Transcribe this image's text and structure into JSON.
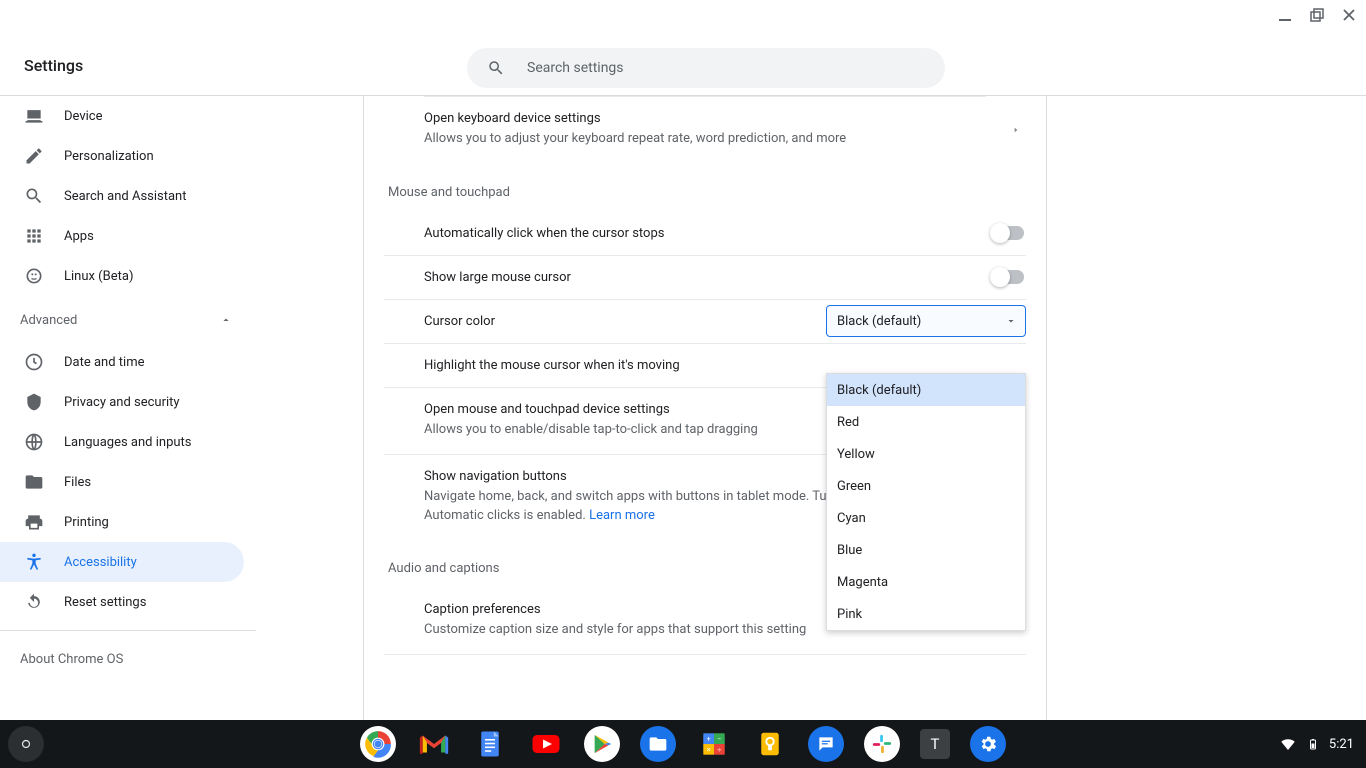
{
  "windowControls": [
    "minimize",
    "restore",
    "close"
  ],
  "header": {
    "title": "Settings",
    "searchPlaceholder": "Search settings"
  },
  "sidebar": {
    "items": [
      {
        "id": "device",
        "label": "Device"
      },
      {
        "id": "personalization",
        "label": "Personalization"
      },
      {
        "id": "search-assistant",
        "label": "Search and Assistant"
      },
      {
        "id": "apps",
        "label": "Apps"
      },
      {
        "id": "linux-beta",
        "label": "Linux (Beta)"
      }
    ],
    "advancedLabel": "Advanced",
    "advancedExpanded": true,
    "advancedItems": [
      {
        "id": "date-time",
        "label": "Date and time"
      },
      {
        "id": "privacy-security",
        "label": "Privacy and security"
      },
      {
        "id": "languages-inputs",
        "label": "Languages and inputs"
      },
      {
        "id": "files",
        "label": "Files"
      },
      {
        "id": "printing",
        "label": "Printing"
      },
      {
        "id": "accessibility",
        "label": "Accessibility",
        "active": true
      },
      {
        "id": "reset-settings",
        "label": "Reset settings"
      }
    ],
    "aboutLabel": "About Chrome OS"
  },
  "main": {
    "keyboardRow": {
      "title": "Open keyboard device settings",
      "subtitle": "Allows you to adjust your keyboard repeat rate, word prediction, and more"
    },
    "mouseSectionTitle": "Mouse and touchpad",
    "rows": {
      "autoClick": {
        "title": "Automatically click when the cursor stops",
        "enabled": false
      },
      "largeCursor": {
        "title": "Show large mouse cursor",
        "enabled": false
      },
      "cursorColor": {
        "title": "Cursor color",
        "selected": "Black (default)",
        "options": [
          "Black (default)",
          "Red",
          "Yellow",
          "Green",
          "Cyan",
          "Blue",
          "Magenta",
          "Pink"
        ],
        "open": true
      },
      "highlightCursor": {
        "title": "Highlight the mouse cursor when it's moving"
      },
      "openMouseSettings": {
        "title": "Open mouse and touchpad device settings",
        "subtitle": "Allows you to enable/disable tap-to-click and tap dragging"
      },
      "navButtons": {
        "title": "Show navigation buttons",
        "subtitle": "Navigate home, back, and switch apps with buttons in tablet mode. Turned on when Switch Access or Automatic clicks is enabled.  ",
        "learnMore": "Learn more"
      }
    },
    "audioSectionTitle": "Audio and captions",
    "captionRow": {
      "title": "Caption preferences",
      "subtitle": "Customize caption size and style for apps that support this setting"
    }
  },
  "shelf": {
    "apps": [
      "chrome",
      "gmail",
      "docs",
      "youtube",
      "play-store",
      "files",
      "calculator",
      "keep",
      "messages",
      "slack",
      "text",
      "settings"
    ],
    "time": "5:21"
  }
}
